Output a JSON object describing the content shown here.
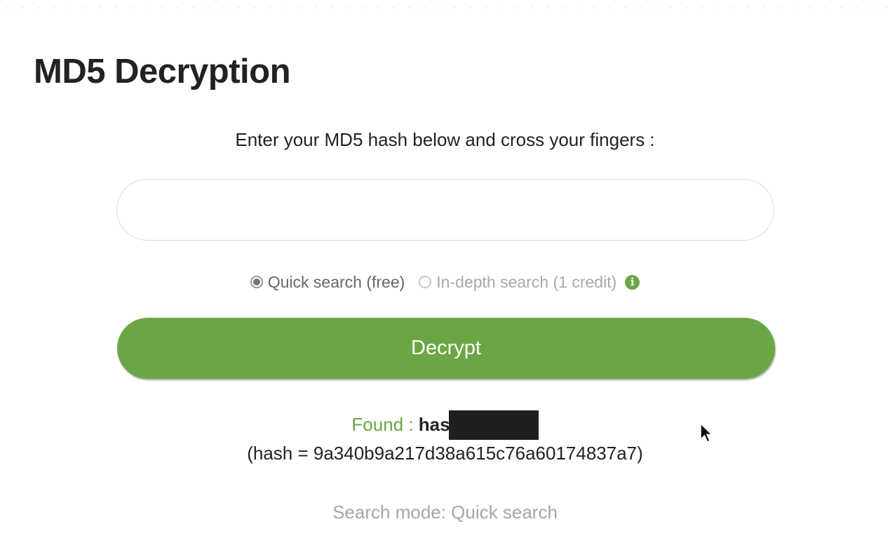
{
  "header": {
    "title": "MD5 Decryption"
  },
  "form": {
    "instructions": "Enter your MD5 hash below and cross your fingers :",
    "hash_input_value": "",
    "hash_input_placeholder": "",
    "search_modes": [
      {
        "label": "Quick search (free)",
        "selected": true
      },
      {
        "label": "In-depth search (1 credit)",
        "selected": false
      }
    ],
    "info_icon": "info-icon",
    "decrypt_label": "Decrypt"
  },
  "result": {
    "found_label": "Found :",
    "found_value_visible": "has",
    "found_value_redacted": true,
    "hash_line": "(hash = 9a340b9a217d38a615c76a60174837a7)",
    "search_mode_text": "Search mode: Quick search"
  },
  "colors": {
    "accent": "#6aa744",
    "title": "#222222",
    "muted": "#a6a6a6"
  }
}
